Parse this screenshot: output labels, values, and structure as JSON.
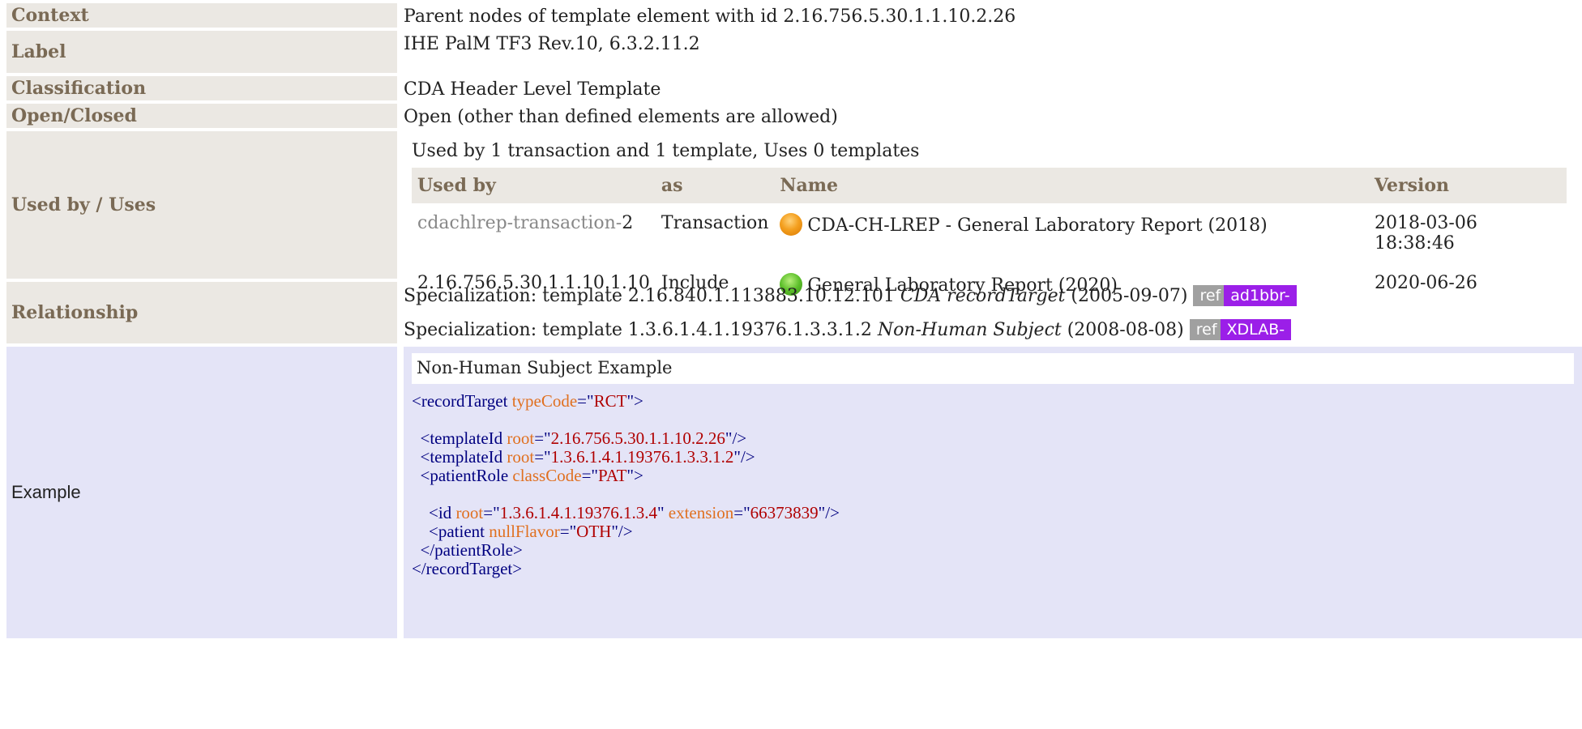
{
  "rows": {
    "context": {
      "label": "Context",
      "value": "Parent nodes of template element with id 2.16.756.5.30.1.1.10.2.26"
    },
    "label": {
      "label": "Label",
      "value": "IHE PalM TF3 Rev.10, 6.3.2.11.2"
    },
    "classification": {
      "label": "Classification",
      "value": "CDA Header Level Template"
    },
    "open_closed": {
      "label": "Open/Closed",
      "value": "Open (other than defined elements are allowed)"
    },
    "used_by": {
      "label": "Used by / Uses",
      "summary": "Used by 1 transaction and 1 template, Uses 0 templates",
      "headers": {
        "used_by": "Used by",
        "as": "as",
        "name": "Name",
        "version": "Version"
      },
      "items": [
        {
          "used_by_prefix": "cdachlrep-transaction-",
          "used_by_suffix": "2",
          "as": "Transaction",
          "status": "orange",
          "name": "CDA-CH-LREP - General Laboratory Report (2018)",
          "version": "2018-03-06 18:38:46"
        },
        {
          "used_by_prefix": "",
          "used_by_suffix": "2.16.756.5.30.1.1.10.1.10",
          "as": "Include",
          "status": "green",
          "name": "General Laboratory Report (2020)",
          "version": "2020-06-26"
        }
      ]
    },
    "relationship": {
      "label": "Relationship",
      "items": [
        {
          "prefix": "Specialization: template 2.16.840.1.113883.10.12.101 ",
          "name": "CDA recordTarget",
          "date": " (2005-09-07)",
          "ref": "ref",
          "tag": "ad1bbr-"
        },
        {
          "prefix": "Specialization: template 1.3.6.1.4.1.19376.1.3.3.1.2 ",
          "name": "Non-Human Subject",
          "date": " (2008-08-08)",
          "ref": "ref",
          "tag": "XDLAB-"
        }
      ]
    },
    "example": {
      "label": "Example",
      "title": "Non-Human Subject Example"
    }
  }
}
